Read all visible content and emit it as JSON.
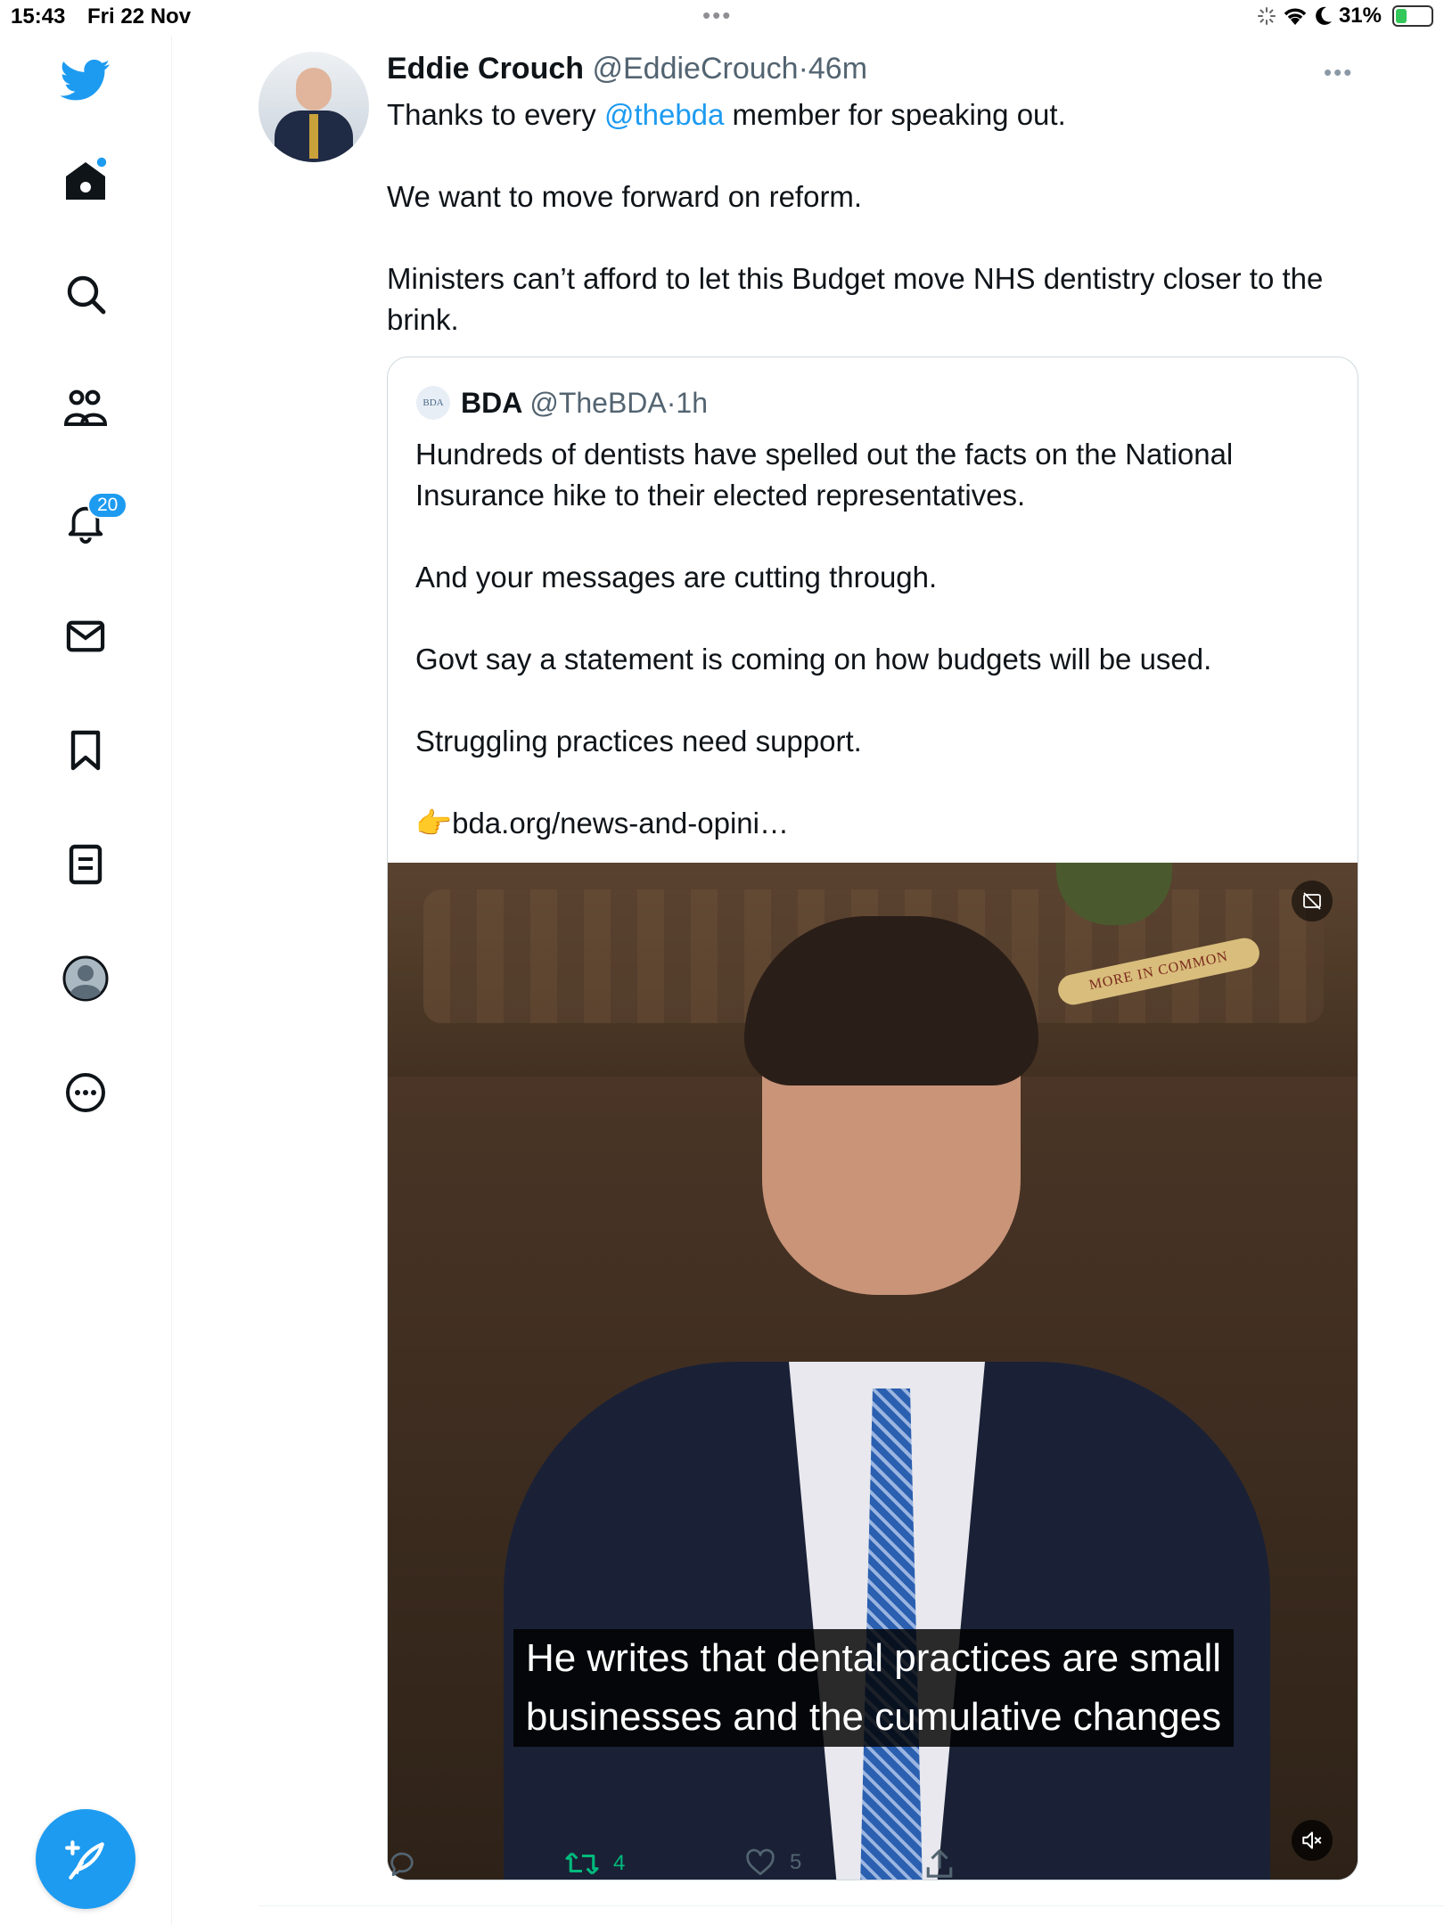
{
  "status_bar": {
    "time": "15:43",
    "date": "Fri 22 Nov",
    "battery": "31%",
    "battery_level": 0.31
  },
  "sidebar": {
    "items": [
      {
        "icon": "twitter-bird-icon"
      },
      {
        "icon": "home-icon"
      },
      {
        "icon": "search-icon"
      },
      {
        "icon": "communities-icon"
      },
      {
        "icon": "notifications-bell-icon",
        "badge": "20"
      },
      {
        "icon": "messages-envelope-icon"
      },
      {
        "icon": "bookmark-icon"
      },
      {
        "icon": "lists-icon"
      },
      {
        "icon": "profile-avatar-icon"
      },
      {
        "icon": "more-circle-icon"
      }
    ],
    "compose_icon": "compose-feather-icon"
  },
  "tweet": {
    "author_name": "Eddie Crouch",
    "author_handle": "@EddieCrouch",
    "separator": "·",
    "time": "46m",
    "text": {
      "p1_before": "Thanks to every ",
      "p1_mention": "@thebda",
      "p1_after": " member for speaking out.",
      "p2": "We want to move forward on reform.",
      "p3": "Ministers can’t afford to let this Budget move NHS dentistry closer to the brink."
    },
    "quote": {
      "logo_text": "BDA",
      "author_name": "BDA",
      "author_handle": "@TheBDA",
      "separator": "·",
      "time": "1h",
      "paragraphs": [
        "Hundreds of dentists have spelled out the facts on the National Insurance hike to their elected representatives.",
        "And your messages are cutting through.",
        "Govt say a statement is coming on how budgets will be used.",
        "Struggling practices need support.",
        "👉bda.org/news-and-opini…"
      ],
      "video": {
        "scroll_text": "MORE IN COMMON",
        "caption_line1": "He writes that dental practices are small",
        "caption_line2": "businesses and the cumulative changes"
      }
    },
    "actions": {
      "reply_count": "",
      "retweet_count": "4",
      "like_count": "5"
    }
  },
  "colors": {
    "accent": "#1d9bf0",
    "retweet_green": "#00ba7c",
    "secondary_text": "#536471"
  }
}
